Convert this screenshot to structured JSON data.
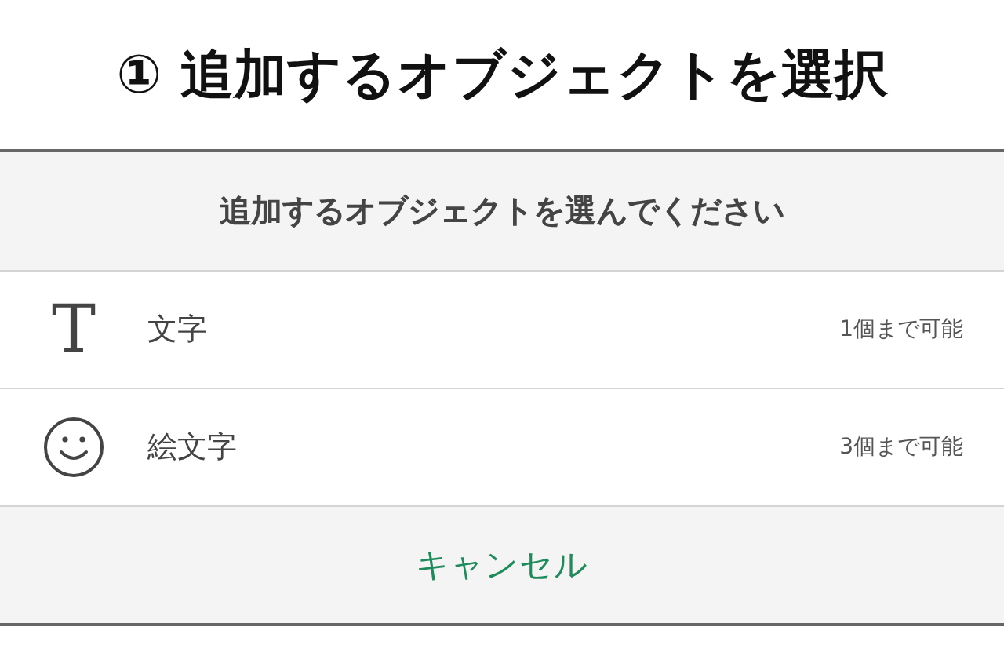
{
  "heading": "① 追加するオブジェクトを選択",
  "sheet": {
    "title": "追加するオブジェクトを選んでください",
    "items": [
      {
        "kind": "text",
        "icon": "T",
        "label": "文字",
        "limit": "1個まで可能"
      },
      {
        "kind": "emoji",
        "label": "絵文字",
        "limit": "3個まで可能"
      }
    ],
    "cancel": "キャンセル"
  }
}
